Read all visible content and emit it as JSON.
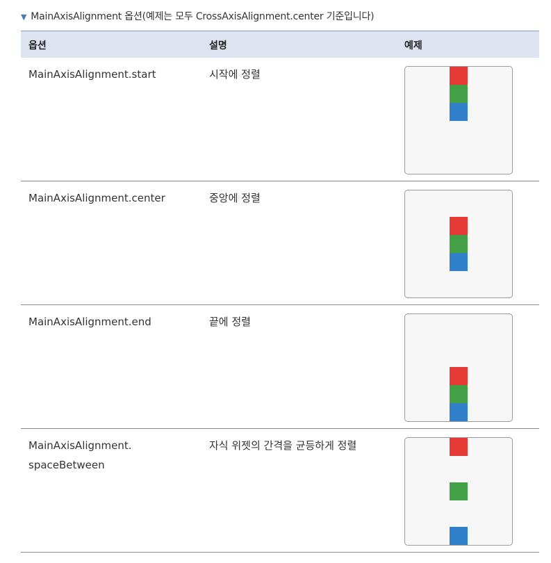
{
  "caption": {
    "marker": "▼",
    "text": "MainAxisAlignment 옵션(예제는 모두 CrossAxisAlignment.center 기준입니다)"
  },
  "table": {
    "headers": [
      "옵션",
      "설명",
      "예제"
    ],
    "rows": [
      {
        "option": "MainAxisAlignment.start",
        "description": "시작에 정렬",
        "alignment": "start"
      },
      {
        "option": "MainAxisAlignment.center",
        "description": "중앙에 정렬",
        "alignment": "center"
      },
      {
        "option": "MainAxisAlignment.end",
        "description": "끝에 정렬",
        "alignment": "end"
      },
      {
        "option": "MainAxisAlignment.\nspaceBetween",
        "description": "자식 위젯의 간격을 균등하게 정렬",
        "alignment": "spaceBetween"
      }
    ]
  },
  "colors": {
    "box_colors": [
      "#e53935",
      "#43a047",
      "#2f80c9"
    ],
    "header_bg": "#dde3f0"
  }
}
